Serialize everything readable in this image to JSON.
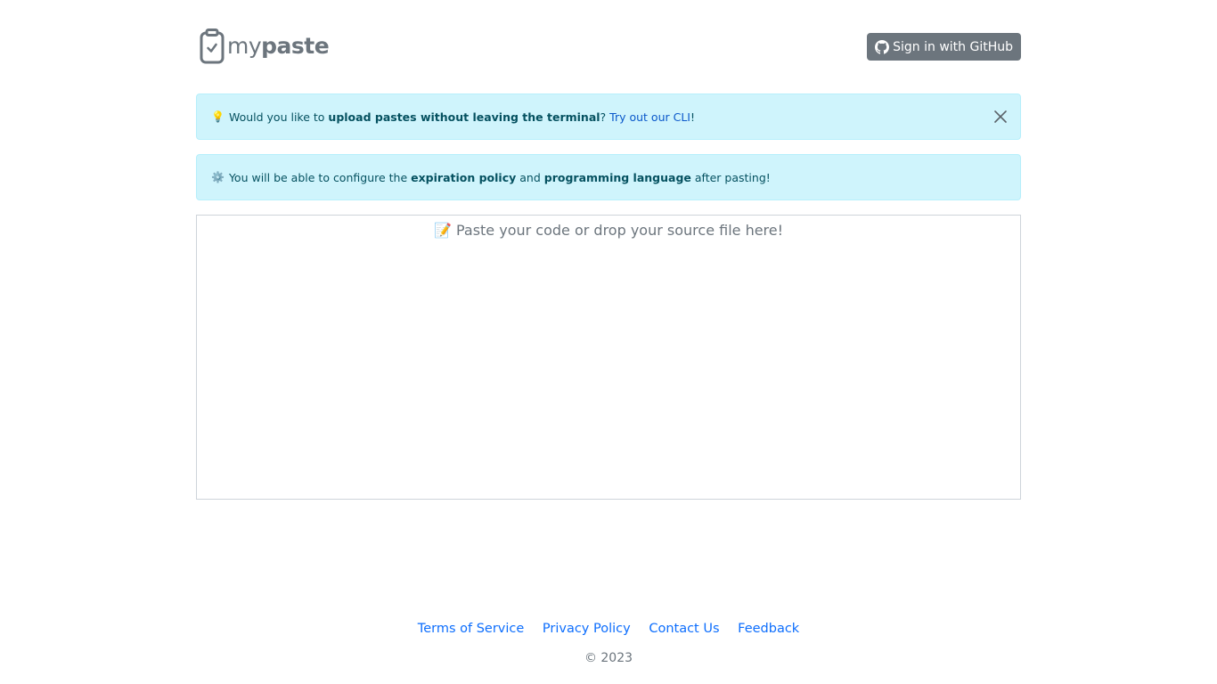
{
  "header": {
    "logo_text_light": "my",
    "logo_text_bold": "paste",
    "signin_label": "Sign in with GitHub"
  },
  "alerts": {
    "cli": {
      "emoji": "💡",
      "text_before": "Would you like to",
      "bold": "upload pastes without leaving the terminal",
      "text_mid": "?",
      "link": "Try out our CLI",
      "text_after": "!"
    },
    "config": {
      "emoji": "⚙️",
      "text_before": "You will be able to configure the",
      "bold1": "expiration policy",
      "text_and": "and",
      "bold2": "programming language",
      "text_after": "after pasting!"
    }
  },
  "paste": {
    "placeholder": "📝 Paste your code or drop your source file here!"
  },
  "footer": {
    "links": [
      "Terms of Service",
      "Privacy Policy",
      "Contact Us",
      "Feedback"
    ],
    "copyright": "© 2023"
  },
  "colors": {
    "alert_bg": "#cff4fc",
    "alert_text": "#055160",
    "link": "#0d6efd",
    "button_bg": "#6c757d"
  }
}
